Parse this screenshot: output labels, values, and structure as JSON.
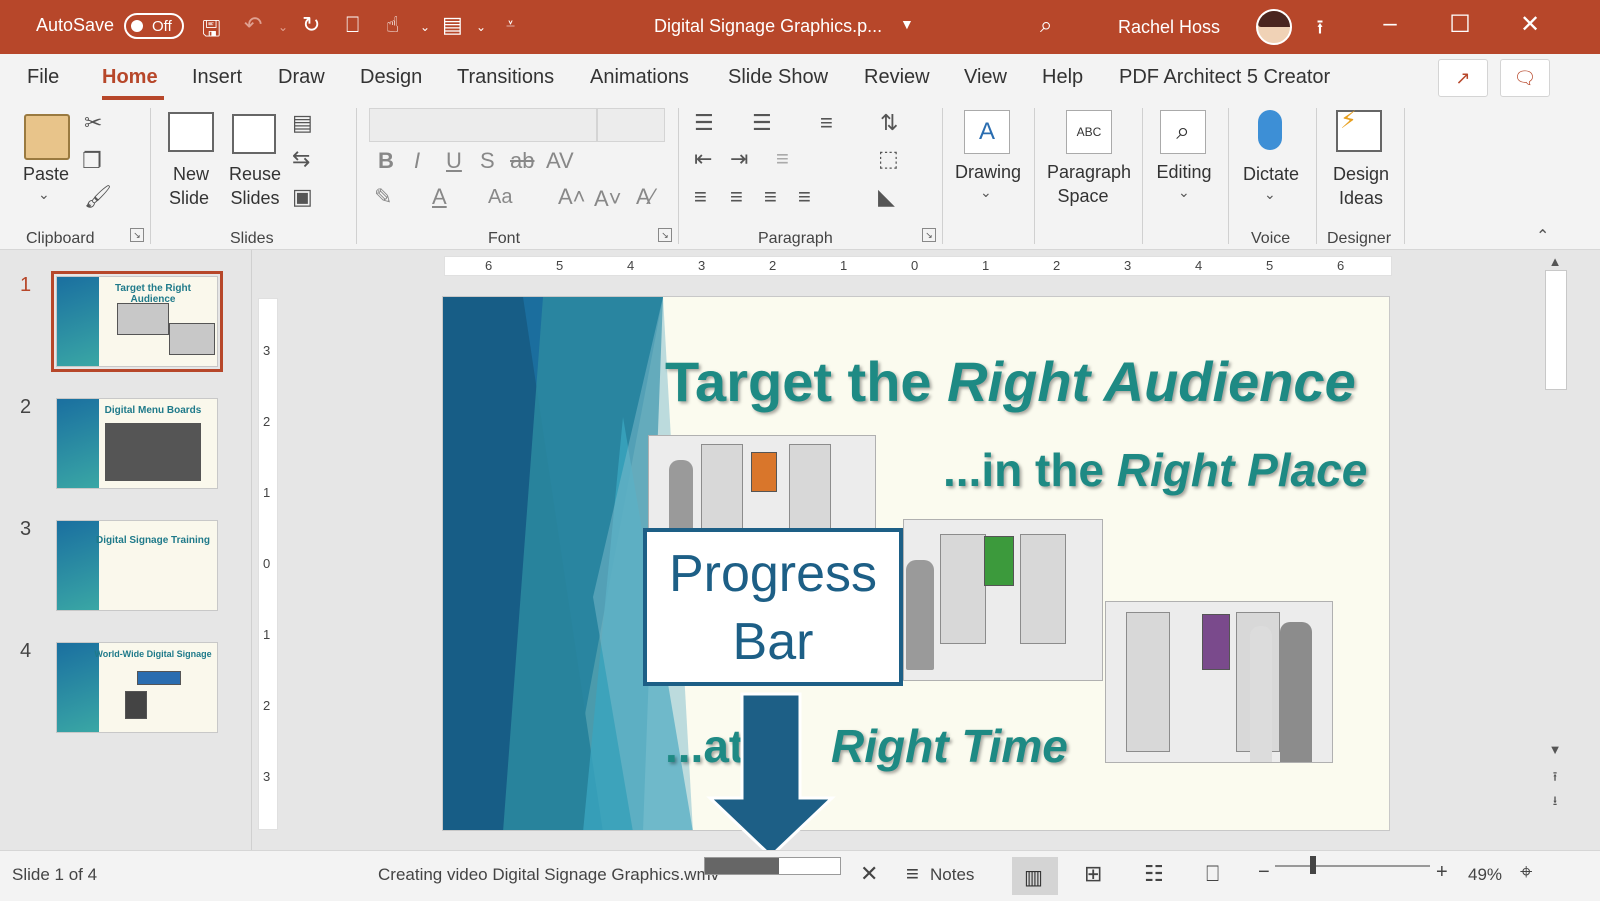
{
  "titlebar": {
    "autosave_label": "AutoSave",
    "autosave_state": "Off",
    "doc_title": "Digital Signage Graphics.p...",
    "user_name": "Rachel Hoss"
  },
  "tabs": [
    "File",
    "Home",
    "Insert",
    "Draw",
    "Design",
    "Transitions",
    "Animations",
    "Slide Show",
    "Review",
    "View",
    "Help",
    "PDF Architect 5 Creator"
  ],
  "ribbon": {
    "paste": "Paste",
    "new_slide_1": "New",
    "new_slide_2": "Slide",
    "reuse_1": "Reuse",
    "reuse_2": "Slides",
    "drawing": "Drawing",
    "para_space_1": "Paragraph",
    "para_space_2": "Space",
    "editing": "Editing",
    "dictate": "Dictate",
    "design_1": "Design",
    "design_2": "Ideas",
    "groups": {
      "clipboard": "Clipboard",
      "slides": "Slides",
      "font": "Font",
      "paragraph": "Paragraph",
      "voice": "Voice",
      "designer": "Designer"
    }
  },
  "thumbnails": [
    {
      "num": "1",
      "title": "Target the Right Audience"
    },
    {
      "num": "2",
      "title": "Digital Menu Boards"
    },
    {
      "num": "3",
      "title": "Digital Signage Training"
    },
    {
      "num": "4",
      "title": "World-Wide Digital Signage"
    }
  ],
  "ruler": {
    "h": [
      "6",
      "5",
      "4",
      "3",
      "2",
      "1",
      "0",
      "1",
      "2",
      "3",
      "4",
      "5",
      "6"
    ],
    "v": [
      "3",
      "2",
      "1",
      "0",
      "1",
      "2",
      "3"
    ]
  },
  "slide": {
    "title_plain": "Target the ",
    "title_italic": "Right Audience",
    "line2_plain": "...in the ",
    "line2_italic": "Right Place",
    "line3_plain": "...at ",
    "line3_italic": "Right Time"
  },
  "callout": {
    "line1": "Progress",
    "line2": "Bar"
  },
  "status": {
    "slide_info": "Slide 1 of 4",
    "creating": "Creating video Digital Signage Graphics.wmv",
    "progress": 0.55,
    "notes": "Notes",
    "zoom": "49%"
  },
  "colors": {
    "accent": "#b7472a",
    "callout": "#1d5f86",
    "slide_title": "#1e8a84"
  }
}
